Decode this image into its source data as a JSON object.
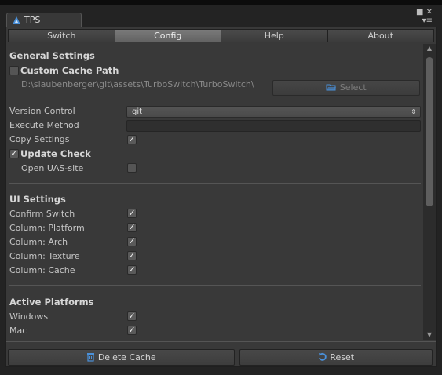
{
  "window": {
    "tab_title": "TPS",
    "tab_icon": "unity-icon",
    "controls": [
      "pin-icon",
      "close-icon",
      "menu-icon"
    ]
  },
  "toolbar": {
    "tabs": [
      {
        "label": "Switch",
        "active": false
      },
      {
        "label": "Config",
        "active": true
      },
      {
        "label": "Help",
        "active": false
      },
      {
        "label": "About",
        "active": false
      }
    ]
  },
  "general": {
    "title": "General Settings",
    "custom_cache_label": "Custom Cache Path",
    "custom_cache_checked": false,
    "cache_path": "D:\\slaubenberger\\git\\assets\\TurboSwitch\\TurboSwitch\\",
    "select_label": "Select",
    "version_control_label": "Version Control",
    "version_control_value": "git",
    "execute_method_label": "Execute Method",
    "execute_method_value": "",
    "copy_settings_label": "Copy Settings",
    "copy_settings_checked": true,
    "update_check_label": "Update Check",
    "update_check_checked": true,
    "open_uas_label": "Open UAS-site",
    "open_uas_checked": false
  },
  "ui_settings": {
    "title": "UI Settings",
    "items": [
      {
        "label": "Confirm Switch",
        "checked": true
      },
      {
        "label": "Column: Platform",
        "checked": true
      },
      {
        "label": "Column: Arch",
        "checked": true
      },
      {
        "label": "Column: Texture",
        "checked": true
      },
      {
        "label": "Column: Cache",
        "checked": true
      }
    ]
  },
  "platforms": {
    "title": "Active Platforms",
    "items": [
      {
        "label": "Windows",
        "checked": true
      },
      {
        "label": "Mac",
        "checked": true
      }
    ]
  },
  "footer": {
    "delete_label": "Delete Cache",
    "reset_label": "Reset"
  },
  "colors": {
    "accent_icon": "#4a90d9",
    "background": "#393939"
  }
}
